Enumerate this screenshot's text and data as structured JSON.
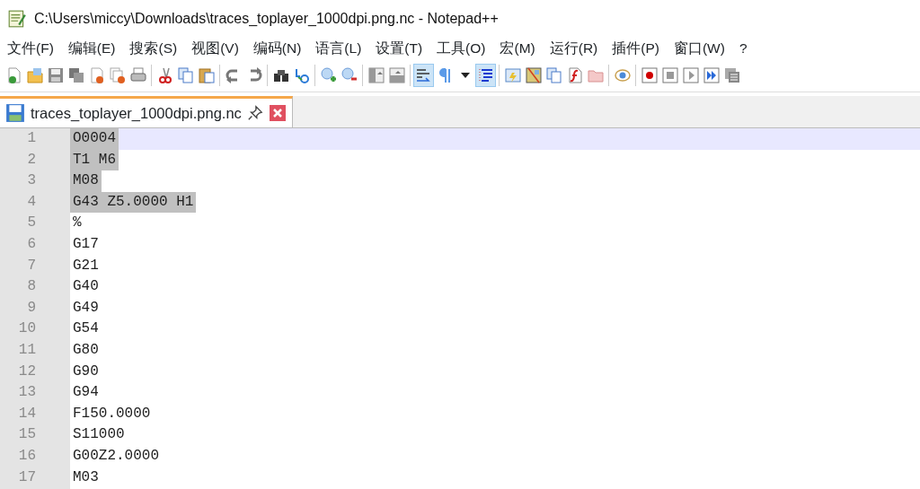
{
  "window": {
    "title": "C:\\Users\\miccy\\Downloads\\traces_toplayer_1000dpi.png.nc - Notepad++"
  },
  "menu": [
    "文件(F)",
    "编辑(E)",
    "搜索(S)",
    "视图(V)",
    "编码(N)",
    "语言(L)",
    "设置(T)",
    "工具(O)",
    "宏(M)",
    "运行(R)",
    "插件(P)",
    "窗口(W)",
    "?"
  ],
  "toolbar": [
    [
      {
        "selected": false
      },
      {
        "selected": false
      },
      {
        "selected": false
      },
      {
        "selected": false
      },
      {
        "selected": false
      },
      {
        "selected": false
      },
      {
        "selected": false
      }
    ],
    [
      {
        "selected": false
      },
      {
        "selected": false
      },
      {
        "selected": false
      }
    ],
    [
      {
        "selected": false
      },
      {
        "selected": false
      }
    ],
    [
      {
        "selected": false
      },
      {
        "selected": false
      }
    ],
    [
      {
        "selected": false
      },
      {
        "selected": false
      }
    ],
    [
      {
        "selected": false
      },
      {
        "selected": false
      }
    ],
    [
      {
        "selected": true
      },
      {
        "selected": false
      },
      {
        "selected": false
      },
      {
        "selected": true
      }
    ],
    [
      {
        "selected": false
      },
      {
        "selected": false
      },
      {
        "selected": false
      },
      {
        "selected": false
      },
      {
        "selected": false
      }
    ],
    [
      {
        "selected": false
      }
    ],
    [
      {
        "selected": false
      },
      {
        "selected": false
      },
      {
        "selected": false
      },
      {
        "selected": false
      },
      {
        "selected": false
      }
    ]
  ],
  "tabs": [
    {
      "label": "traces_toplayer_1000dpi.png.nc",
      "selected": true
    }
  ],
  "lines": [
    {
      "number": "1",
      "text": "O0004",
      "selected": true,
      "current": true
    },
    {
      "number": "2",
      "text": "T1 M6",
      "selected": true,
      "current": false
    },
    {
      "number": "3",
      "text": "M08",
      "selected": true,
      "current": false
    },
    {
      "number": "4",
      "text": "G43 Z5.0000 H1",
      "selected": true,
      "current": false
    },
    {
      "number": "5",
      "text": "%",
      "selected": false,
      "current": false
    },
    {
      "number": "6",
      "text": "G17",
      "selected": false,
      "current": false
    },
    {
      "number": "7",
      "text": "G21",
      "selected": false,
      "current": false
    },
    {
      "number": "8",
      "text": "G40",
      "selected": false,
      "current": false
    },
    {
      "number": "9",
      "text": "G49",
      "selected": false,
      "current": false
    },
    {
      "number": "10",
      "text": "G54",
      "selected": false,
      "current": false
    },
    {
      "number": "11",
      "text": "G80",
      "selected": false,
      "current": false
    },
    {
      "number": "12",
      "text": "G90",
      "selected": false,
      "current": false
    },
    {
      "number": "13",
      "text": "G94",
      "selected": false,
      "current": false
    },
    {
      "number": "14",
      "text": "F150.0000",
      "selected": false,
      "current": false
    },
    {
      "number": "15",
      "text": "S11000",
      "selected": false,
      "current": false
    },
    {
      "number": "16",
      "text": "G00Z2.0000",
      "selected": false,
      "current": false
    },
    {
      "number": "17",
      "text": "M03",
      "selected": false,
      "current": false
    }
  ]
}
